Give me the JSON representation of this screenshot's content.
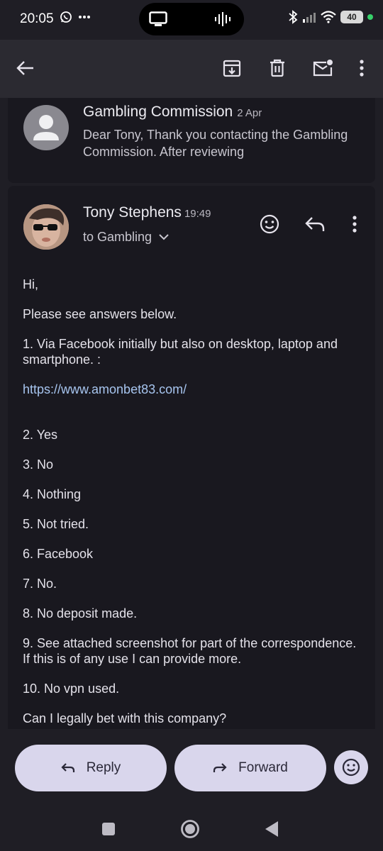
{
  "status_bar": {
    "time": "20:05",
    "battery": "40"
  },
  "toolbar": {
    "back_icon": "arrow-left-icon",
    "archive_icon": "archive-icon",
    "delete_icon": "trash-icon",
    "mark_unread_icon": "mark-unread-icon",
    "more_icon": "more-vertical-icon"
  },
  "previous_message": {
    "sender": "Gambling Commission",
    "date": "2 Apr",
    "snippet": "Dear Tony, Thank you contacting the Gambling Commission. After reviewing"
  },
  "message": {
    "sender": "Tony Stephens",
    "time": "19:49",
    "to": "to Gambling",
    "body": {
      "greeting": "Hi,",
      "intro": "Please see answers below.",
      "a1": "1. Via Facebook initially but also on desktop, laptop and smartphone. :",
      "link": "https://www.amonbet83.com/",
      "a2": "2. Yes",
      "a3": "3. No",
      "a4": "4. Nothing",
      "a5": "5. Not tried.",
      "a6": "6. Facebook",
      "a7": "7. No.",
      "a8": "8. No deposit made.",
      "a9": "9.  See attached screenshot for part of the correspondence. If this is of any use I can provide more.",
      "a10": "10. No vpn used.",
      "question": "Can I legally bet with this company?"
    }
  },
  "actions": {
    "reply_label": "Reply",
    "forward_label": "Forward"
  },
  "colors": {
    "background": "#1f1e25",
    "card": "#19181f",
    "toolbar": "#2b2a31",
    "pill_button": "#d9d6ec",
    "link": "#a7c5ef",
    "status_dot": "#37d06a"
  }
}
